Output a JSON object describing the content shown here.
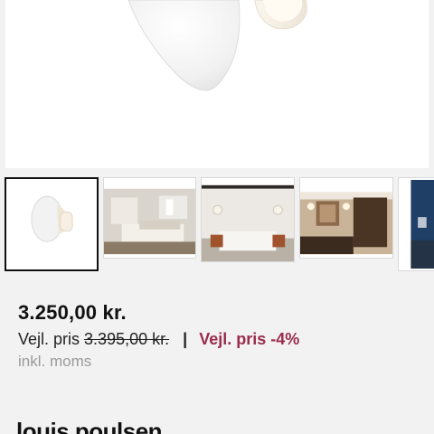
{
  "gallery": {
    "thumbnails": [
      {
        "name": "Lamp product photo",
        "selected": true
      },
      {
        "name": "Bedroom with wall lamps",
        "selected": false
      },
      {
        "name": "Room with two wall lamps",
        "selected": false
      },
      {
        "name": "Hotel room interior",
        "selected": false
      },
      {
        "name": "Blue wall interior",
        "selected": false
      }
    ]
  },
  "product": {
    "price": "3.250,00 kr.",
    "compare_label": "Vejl. pris",
    "compare_price": "3.395,00 kr.",
    "separator": "|",
    "discount_label": "Vejl. pris -4%",
    "vat_note": "inkl. moms"
  },
  "brand": {
    "name": "louis poulsen"
  },
  "colors": {
    "discount": "#9b2c4c",
    "background": "#f2f2f2",
    "selected_border": "#111111"
  }
}
